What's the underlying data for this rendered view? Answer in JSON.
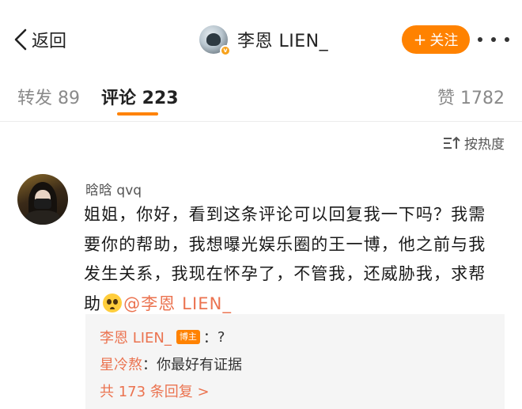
{
  "nav": {
    "back_label": "返回",
    "profile_name": "李恩 LIEN_",
    "follow_label": "关注",
    "colors": {
      "accent": "#ff8200",
      "link": "#eb7350"
    },
    "icons": {
      "back": "chevron-left-icon",
      "more": "more-dots-icon",
      "verified": "verified-badge-icon"
    }
  },
  "tabs": {
    "repost": "转发 89",
    "comments": "评论 223",
    "likes": "赞 1782"
  },
  "sort": {
    "label": "按热度",
    "icon": "sort-icon"
  },
  "comment": {
    "author": "晗晗 qvq",
    "text": "姐姐，你好，看到这条评论可以回复我一下吗？我需要你的帮助，我想曝光娱乐圈的王一博，他之前与我发生关系，我现在怀孕了，不管我，还威胁我，求帮助",
    "emoji": "pleading-face-emoji",
    "mention": "@李恩 LIEN_"
  },
  "replies": {
    "items": [
      {
        "author": "李恩 LIEN_",
        "badge": "博主",
        "sep": "：",
        "text": "?"
      },
      {
        "author": "星冷熬",
        "sep": "：",
        "text": "你最好有证据"
      }
    ],
    "view_more": "共 173 条回复 >"
  }
}
